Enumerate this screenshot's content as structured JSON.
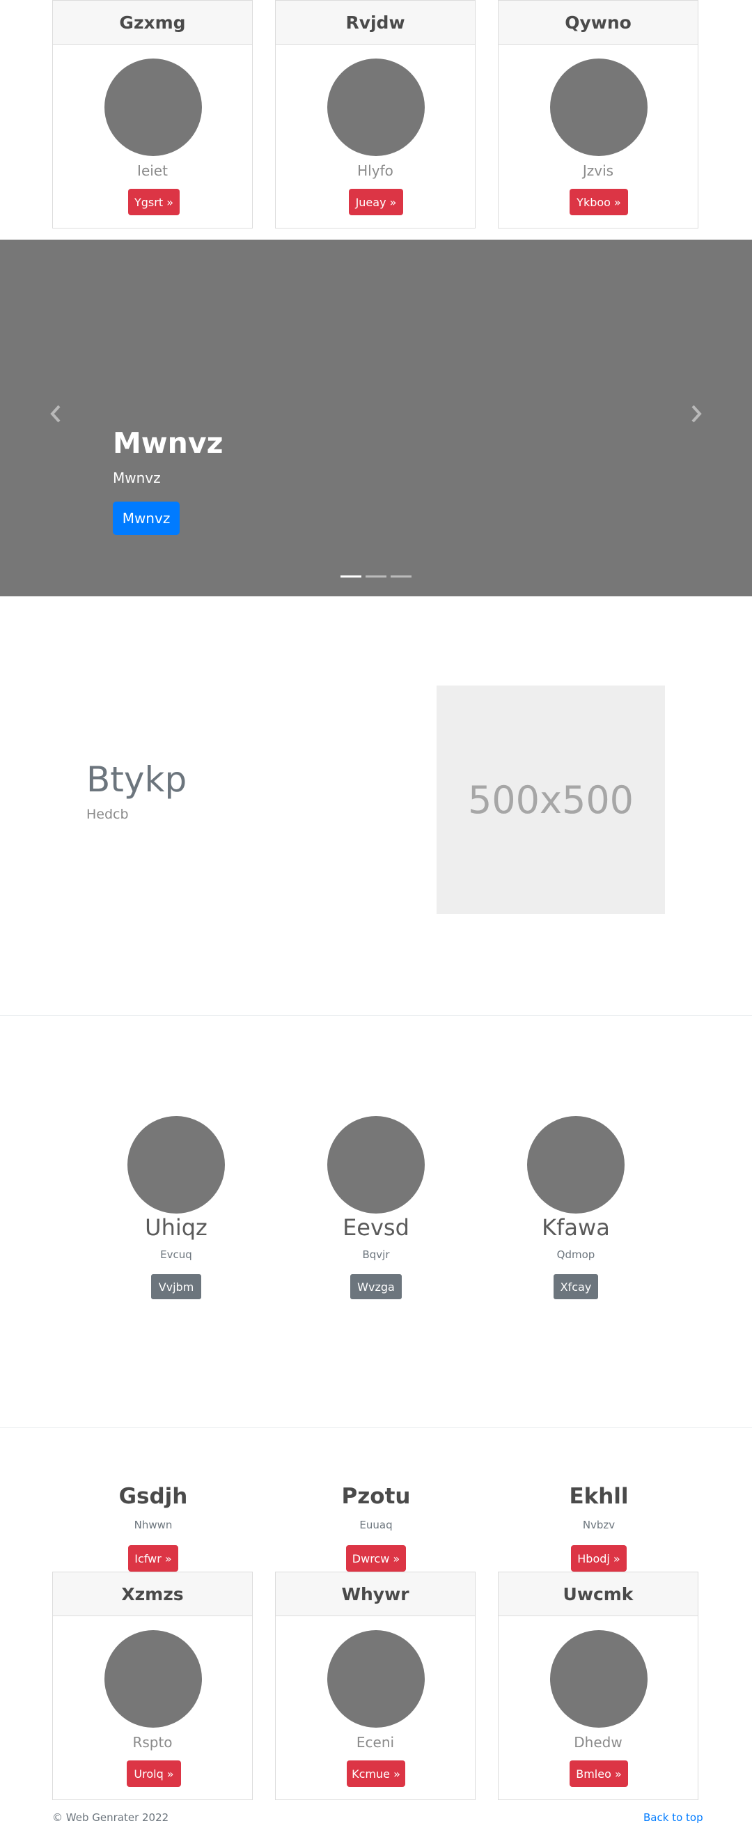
{
  "top_cards": [
    {
      "title": "Gzxmg",
      "text": "Ieiet",
      "button": "Ygsrt »"
    },
    {
      "title": "Rvjdw",
      "text": "Hlyfo",
      "button": "Jueay »"
    },
    {
      "title": "Qywno",
      "text": "Jzvis",
      "button": "Ykboo »"
    }
  ],
  "carousel": {
    "title": "Mwnvz",
    "subtitle": "Mwnvz",
    "button": "Mwnvz",
    "prev_icon": "chevron-left-icon",
    "next_icon": "chevron-right-icon",
    "slide_count": 3,
    "active_slide": 1
  },
  "feature": {
    "title": "Btykp",
    "subtitle": "Hedcb",
    "image_label": "500x500"
  },
  "team": [
    {
      "name": "Uhiqz",
      "role": "Evcuq",
      "button": "Vvjbm"
    },
    {
      "name": "Eevsd",
      "role": "Bqvjr",
      "button": "Wvzga"
    },
    {
      "name": "Kfawa",
      "role": "Qdmop",
      "button": "Xfcay"
    }
  ],
  "columns": [
    {
      "title": "Gsdjh",
      "text": "Nhwwn",
      "button": "Icfwr »"
    },
    {
      "title": "Pzotu",
      "text": "Euuaq",
      "button": "Dwrcw »"
    },
    {
      "title": "Ekhll",
      "text": "Nvbzv",
      "button": "Hbodj »"
    }
  ],
  "bottom_cards": [
    {
      "title": "Xzmzs",
      "text": "Rspto",
      "button": "Urolq »"
    },
    {
      "title": "Whywr",
      "text": "Eceni",
      "button": "Kcmue »"
    },
    {
      "title": "Uwcmk",
      "text": "Dhedw",
      "button": "Bmleo »"
    }
  ],
  "footer": {
    "copyright": "© Web Genrater 2022",
    "back_to_top": "Back to top"
  },
  "colors": {
    "primary": "#007bff",
    "danger": "#dc3545",
    "secondary": "#6c757d",
    "placeholder": "#777777"
  }
}
